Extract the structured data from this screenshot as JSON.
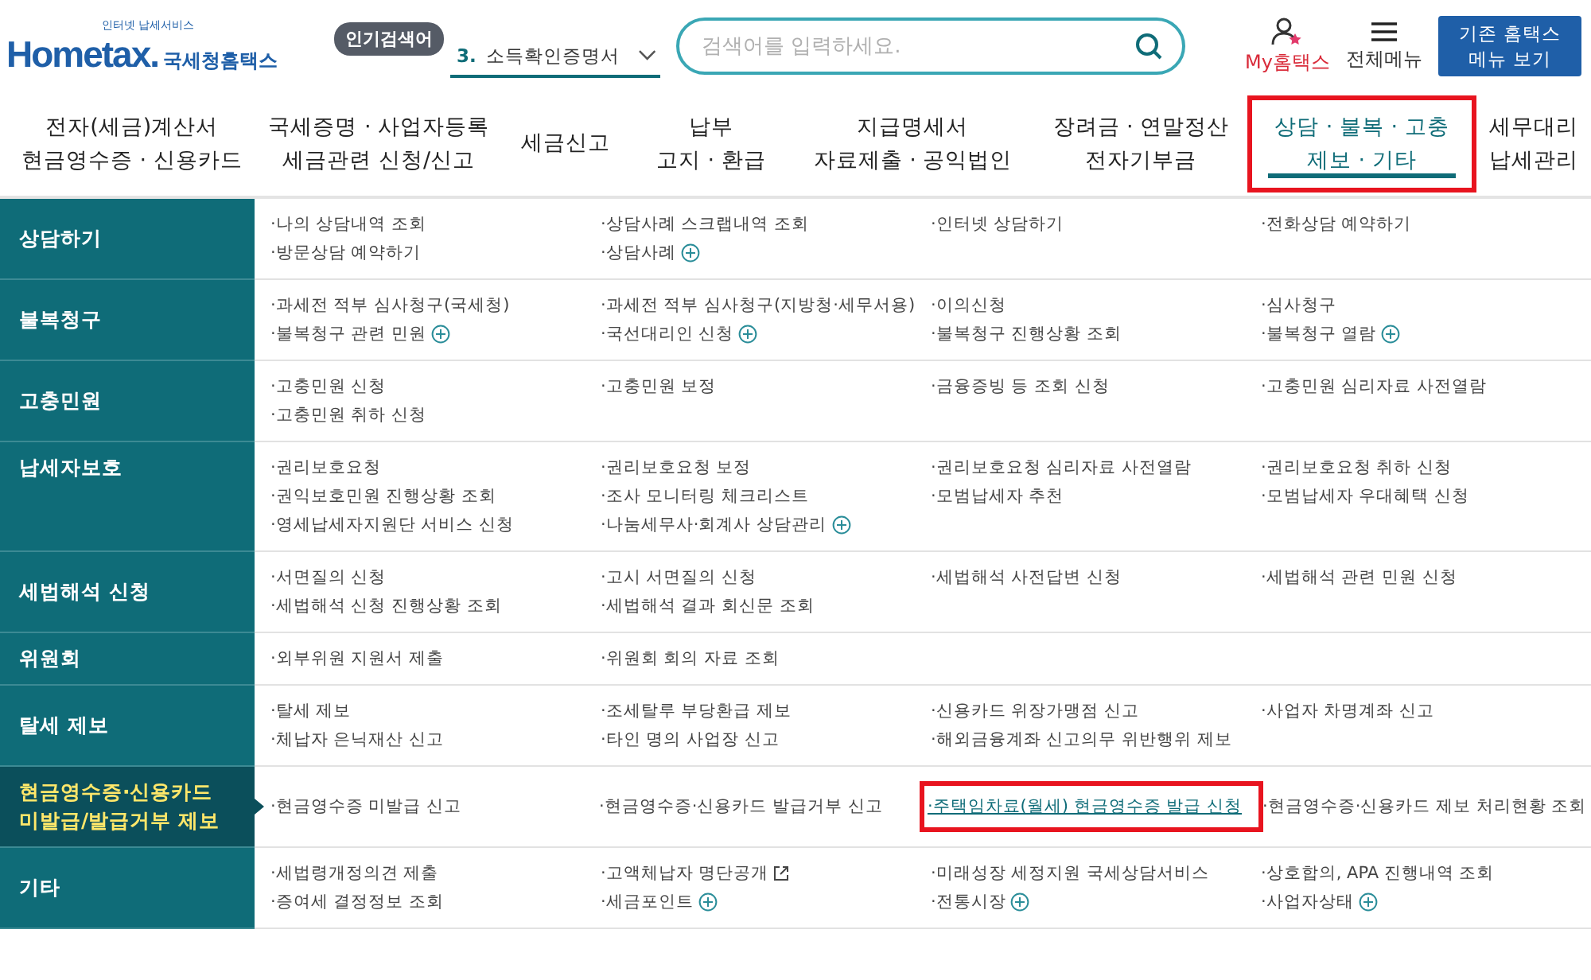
{
  "header": {
    "logo_tagline": "인터넷 납세서비스",
    "logo_word": "Hometax.",
    "logo_name": "국세청홈택스",
    "trending_badge": "인기검색어",
    "trending_rank": "3.",
    "trending_term": "소득확인증명서",
    "search": {
      "placeholder": "검색어를 입력하세요."
    },
    "my_label": "My홈택스",
    "menu_label": "전체메뉴",
    "legacy_button": "기존 홈택스 메뉴 보기"
  },
  "nav": [
    {
      "lines": [
        "전자(세금)계산서",
        "현금영수증 · 신용카드"
      ],
      "selected": false
    },
    {
      "lines": [
        "국세증명 · 사업자등록",
        "세금관련 신청/신고"
      ],
      "selected": false
    },
    {
      "lines": [
        "세금신고"
      ],
      "selected": false
    },
    {
      "lines": [
        "납부",
        "고지 · 환급"
      ],
      "selected": false
    },
    {
      "lines": [
        "지급명세서",
        "자료제출 · 공익법인"
      ],
      "selected": false
    },
    {
      "lines": [
        "장려금 · 연말정산",
        "전자기부금"
      ],
      "selected": false
    },
    {
      "lines": [
        "상담 · 불복 · 고충",
        "제보 · 기타"
      ],
      "selected": true
    },
    {
      "lines": [
        "세무대리",
        "납세관리"
      ],
      "selected": false
    }
  ],
  "sections": [
    {
      "label": "상담하기",
      "selected": false,
      "items": [
        {
          "label": "·나의 상담내역 조회",
          "kind": "plain"
        },
        {
          "label": "·상담사례 스크랩내역 조회",
          "kind": "plain"
        },
        {
          "label": "·인터넷 상담하기",
          "kind": "plain"
        },
        {
          "label": "·전화상담 예약하기",
          "kind": "plain"
        },
        {
          "label": "·방문상담 예약하기",
          "kind": "plain"
        },
        {
          "label": "·상담사례",
          "kind": "expand"
        }
      ]
    },
    {
      "label": "불복청구",
      "selected": false,
      "items": [
        {
          "label": "·과세전 적부 심사청구(국세청)",
          "kind": "plain"
        },
        {
          "label": "·과세전 적부 심사청구(지방청·세무서용)",
          "kind": "plain"
        },
        {
          "label": "·이의신청",
          "kind": "plain"
        },
        {
          "label": "·심사청구",
          "kind": "plain"
        },
        {
          "label": "·불복청구 관련 민원",
          "kind": "expand"
        },
        {
          "label": "·국선대리인 신청",
          "kind": "expand"
        },
        {
          "label": "·불복청구 진행상황 조회",
          "kind": "plain"
        },
        {
          "label": "·불복청구 열람",
          "kind": "expand"
        }
      ]
    },
    {
      "label": "고충민원",
      "selected": false,
      "items": [
        {
          "label": "·고충민원 신청",
          "kind": "plain"
        },
        {
          "label": "·고충민원 보정",
          "kind": "plain"
        },
        {
          "label": "·금융증빙 등 조회 신청",
          "kind": "plain"
        },
        {
          "label": "·고충민원 심리자료 사전열람",
          "kind": "plain"
        },
        {
          "label": "·고충민원 취하 신청",
          "kind": "plain"
        }
      ]
    },
    {
      "label": "납세자보호",
      "selected": false,
      "items": [
        {
          "label": "·권리보호요청",
          "kind": "plain"
        },
        {
          "label": "·권리보호요청 보정",
          "kind": "plain"
        },
        {
          "label": "·권리보호요청 심리자료 사전열람",
          "kind": "plain"
        },
        {
          "label": "·권리보호요청 취하 신청",
          "kind": "plain"
        },
        {
          "label": "·권익보호민원 진행상황 조회",
          "kind": "plain"
        },
        {
          "label": "·조사 모니터링 체크리스트",
          "kind": "plain"
        },
        {
          "label": "·모범납세자 추천",
          "kind": "plain"
        },
        {
          "label": "·모범납세자 우대혜택 신청",
          "kind": "plain"
        },
        {
          "label": "·영세납세자지원단 서비스 신청",
          "kind": "plain"
        },
        {
          "label": "·나눔세무사·회계사 상담관리",
          "kind": "expand"
        }
      ]
    },
    {
      "label": "세법해석 신청",
      "selected": false,
      "items": [
        {
          "label": "·서면질의 신청",
          "kind": "plain"
        },
        {
          "label": "·고시 서면질의 신청",
          "kind": "plain"
        },
        {
          "label": "·세법해석 사전답변 신청",
          "kind": "plain"
        },
        {
          "label": "·세법해석 관련 민원 신청",
          "kind": "plain"
        },
        {
          "label": "·세법해석 신청 진행상황 조회",
          "kind": "plain"
        },
        {
          "label": "·세법해석 결과 회신문 조회",
          "kind": "plain"
        }
      ]
    },
    {
      "label": "위원회",
      "selected": false,
      "items": [
        {
          "label": "·외부위원 지원서 제출",
          "kind": "plain"
        },
        {
          "label": "·위원회 회의 자료 조회",
          "kind": "plain"
        }
      ]
    },
    {
      "label": "탈세 제보",
      "selected": false,
      "items": [
        {
          "label": "·탈세 제보",
          "kind": "plain"
        },
        {
          "label": "·조세탈루 부당환급 제보",
          "kind": "plain"
        },
        {
          "label": "·신용카드 위장가맹점 신고",
          "kind": "plain"
        },
        {
          "label": "·사업자 차명계좌 신고",
          "kind": "plain"
        },
        {
          "label": "·체납자 은닉재산 신고",
          "kind": "plain"
        },
        {
          "label": "·타인 명의 사업장 신고",
          "kind": "plain"
        },
        {
          "label": "·해외금융계좌 신고의무 위반행위 제보",
          "kind": "plain"
        }
      ]
    },
    {
      "label": "현금영수증·신용카드 미발급/발급거부 제보",
      "selected": true,
      "items": [
        {
          "label": "·현금영수증 미발급 신고",
          "kind": "plain"
        },
        {
          "label": "·현금영수증·신용카드 발급거부 신고",
          "kind": "plain"
        },
        {
          "label": "·주택임차료(월세) 현금영수증 발급 신청",
          "kind": "current"
        },
        {
          "label": "·현금영수증·신용카드 제보 처리현황 조회",
          "kind": "plain"
        }
      ]
    },
    {
      "label": "기타",
      "selected": false,
      "items": [
        {
          "label": "·세법령개정의견 제출",
          "kind": "plain"
        },
        {
          "label": "·고액체납자 명단공개",
          "kind": "external"
        },
        {
          "label": "·미래성장 세정지원 국세상담서비스",
          "kind": "plain"
        },
        {
          "label": "·상호합의, APA 진행내역 조회",
          "kind": "plain"
        },
        {
          "label": "·증여세 결정정보 조회",
          "kind": "plain"
        },
        {
          "label": "·세금포인트",
          "kind": "expand"
        },
        {
          "label": "·전통시장",
          "kind": "expand"
        },
        {
          "label": "·사업자상태",
          "kind": "expand"
        }
      ]
    }
  ]
}
